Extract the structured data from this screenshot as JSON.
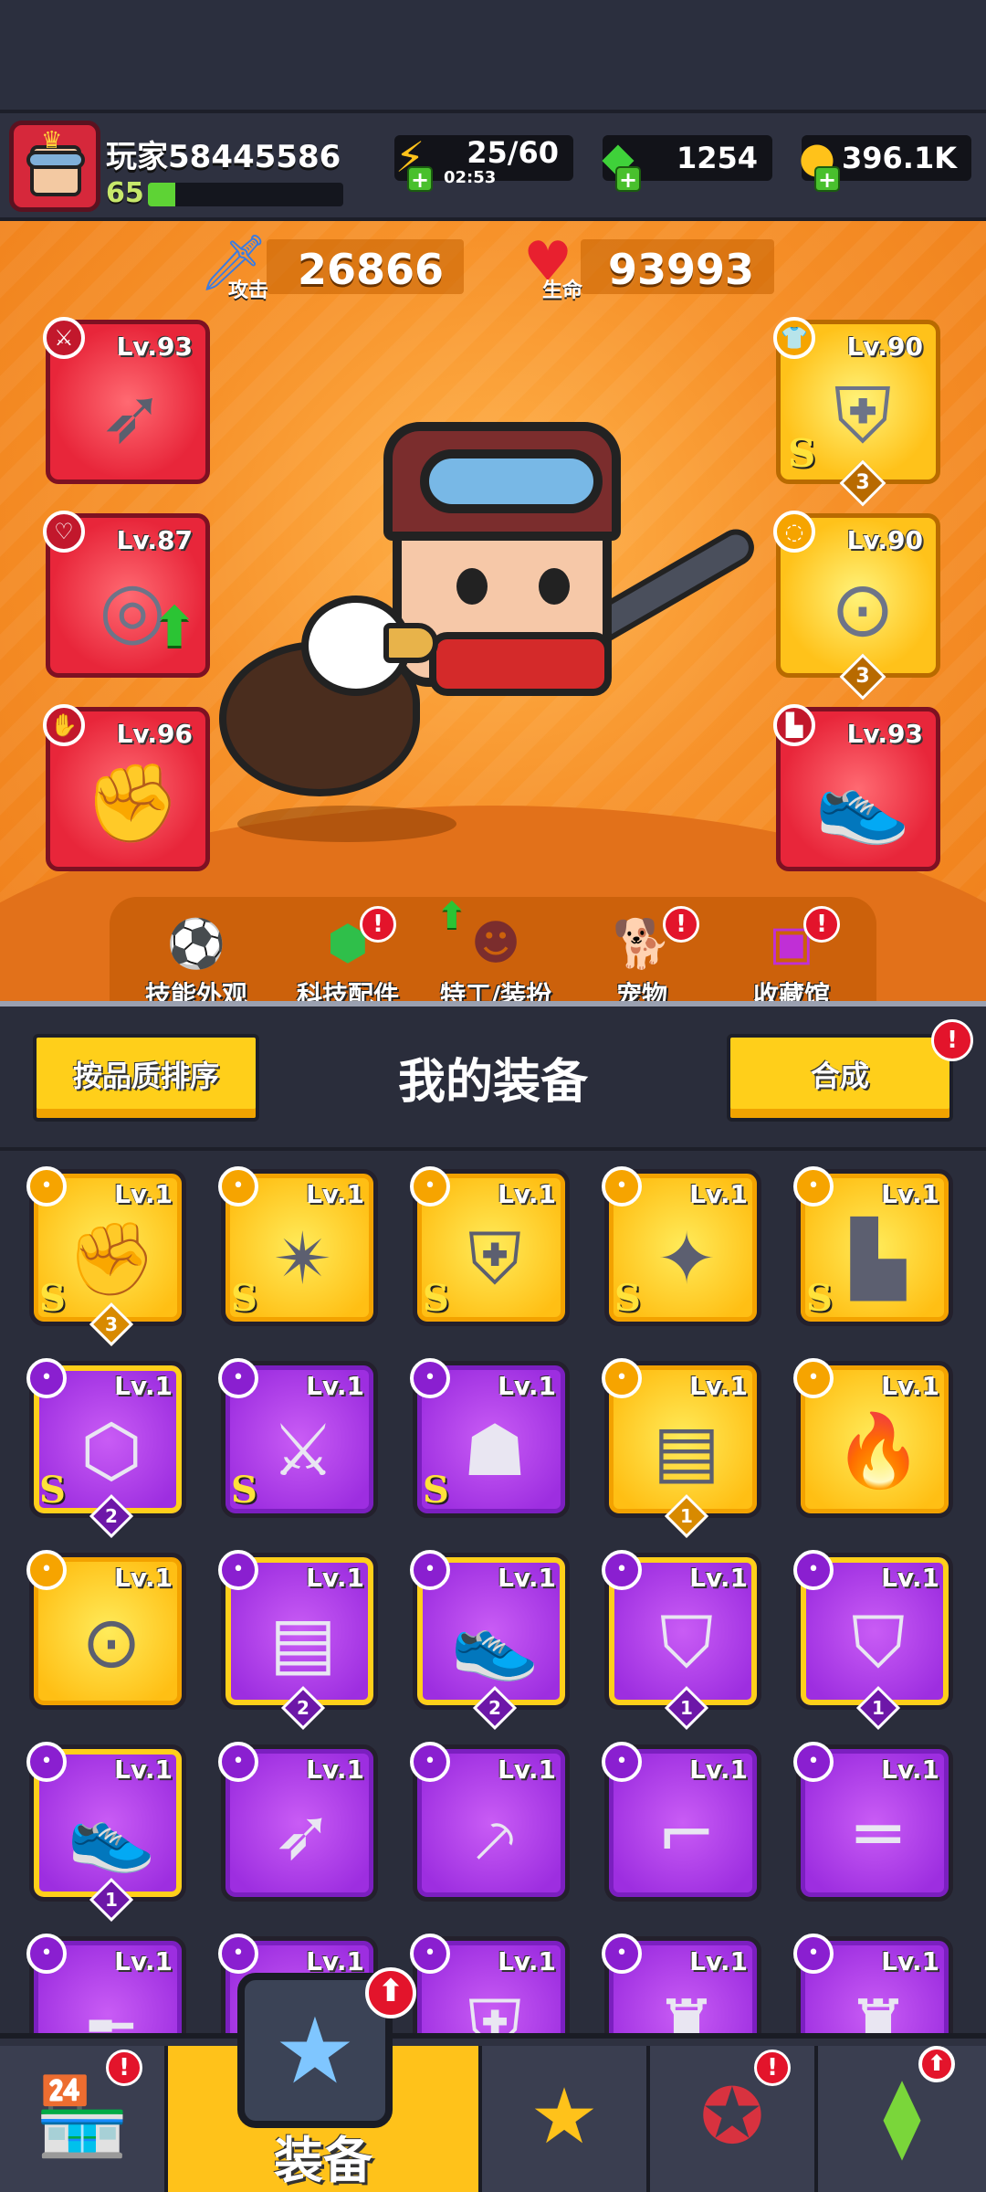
{
  "player": {
    "name": "玩家58445586",
    "level": "65",
    "xp_fraction": 0.14
  },
  "resources": {
    "energy": {
      "value": "25/60",
      "timer": "02:53",
      "icon": "lightning-icon"
    },
    "gems": {
      "value": "1254",
      "icon": "green-gem-icon"
    },
    "coins": {
      "value": "396.1K",
      "icon": "gold-coin-icon"
    }
  },
  "stats": {
    "attack": {
      "label": "攻击",
      "value": "26866",
      "icon": "sword-icon"
    },
    "health": {
      "label": "生命",
      "value": "93993",
      "icon": "heart-icon"
    }
  },
  "equipped": {
    "left": [
      {
        "level": "Lv.93",
        "type": "weapon",
        "icon": "kunai-icon",
        "quality": "red"
      },
      {
        "level": "Lv.87",
        "type": "necklace",
        "icon": "spiked-collar-icon",
        "quality": "red",
        "upgradable": true
      },
      {
        "level": "Lv.96",
        "type": "glove",
        "icon": "gauntlet-icon",
        "quality": "red"
      }
    ],
    "right": [
      {
        "level": "Lv.90",
        "type": "armor",
        "icon": "mech-armor-icon",
        "quality": "gold",
        "grade": "S",
        "stars": "3"
      },
      {
        "level": "Lv.90",
        "type": "belt",
        "icon": "star-belt-icon",
        "quality": "gold",
        "stars": "3"
      },
      {
        "level": "Lv.93",
        "type": "boots",
        "icon": "sneaker-icon",
        "quality": "red"
      }
    ]
  },
  "hero_menu": [
    {
      "label": "技能外观",
      "icon": "skin-ball-icon",
      "alert": false
    },
    {
      "label": "科技配件",
      "icon": "hex-chip-icon",
      "alert": true
    },
    {
      "label": "特工/装扮",
      "icon": "agent-icon",
      "alert": false,
      "upgrade": true
    },
    {
      "label": "宠物",
      "icon": "shiba-icon",
      "alert": true
    },
    {
      "label": "收藏馆",
      "icon": "chest-icon",
      "alert": true
    }
  ],
  "equipment_panel": {
    "sort_label": "按品质排序",
    "title": "我的装备",
    "merge_label": "合成",
    "merge_alert": "!"
  },
  "inventory": [
    {
      "level": "Lv.1",
      "quality": "gold",
      "icon": "gauntlet-icon",
      "grade": "S",
      "stars": "3"
    },
    {
      "level": "Lv.1",
      "quality": "gold",
      "icon": "star-blade-icon",
      "grade": "S"
    },
    {
      "level": "Lv.1",
      "quality": "gold",
      "icon": "mech-armor-icon",
      "grade": "S"
    },
    {
      "level": "Lv.1",
      "quality": "gold",
      "icon": "star-necklace-icon",
      "grade": "S"
    },
    {
      "level": "Lv.1",
      "quality": "gold",
      "icon": "boots-icon",
      "grade": "S"
    },
    {
      "level": "Lv.1",
      "quality": "purple",
      "frame": "gold",
      "icon": "hex-belt-icon",
      "grade": "S",
      "stars": "2"
    },
    {
      "level": "Lv.1",
      "quality": "purple",
      "icon": "fire-sword-icon",
      "grade": "S"
    },
    {
      "level": "Lv.1",
      "quality": "purple",
      "icon": "robot-armor-icon",
      "grade": "S"
    },
    {
      "level": "Lv.1",
      "quality": "gold",
      "icon": "vest-icon",
      "stars": "1"
    },
    {
      "level": "Lv.1",
      "quality": "gold",
      "icon": "torch-icon"
    },
    {
      "level": "Lv.1",
      "quality": "gold",
      "icon": "star-belt-icon"
    },
    {
      "level": "Lv.1",
      "quality": "purple",
      "frame": "gold",
      "icon": "vest-icon",
      "stars": "2"
    },
    {
      "level": "Lv.1",
      "quality": "purple",
      "frame": "gold",
      "icon": "sneaker-icon",
      "stars": "2"
    },
    {
      "level": "Lv.1",
      "quality": "purple",
      "frame": "gold",
      "icon": "shield-necklace-icon",
      "stars": "1"
    },
    {
      "level": "Lv.1",
      "quality": "purple",
      "frame": "gold",
      "icon": "shield-necklace-icon",
      "stars": "1"
    },
    {
      "level": "Lv.1",
      "quality": "purple",
      "frame": "gold",
      "icon": "sneaker-icon",
      "stars": "1"
    },
    {
      "level": "Lv.1",
      "quality": "purple",
      "icon": "kunai-icon"
    },
    {
      "level": "Lv.1",
      "quality": "purple",
      "icon": "machete-icon"
    },
    {
      "level": "Lv.1",
      "quality": "purple",
      "icon": "revolver-icon"
    },
    {
      "level": "Lv.1",
      "quality": "purple",
      "icon": "shotgun-icon"
    },
    {
      "level": "Lv.1",
      "quality": "purple",
      "icon": "rifle-icon"
    },
    {
      "level": "Lv.1",
      "quality": "purple",
      "icon": "armor-icon"
    },
    {
      "level": "Lv.1",
      "quality": "purple",
      "icon": "armor-icon"
    },
    {
      "level": "Lv.1",
      "quality": "purple",
      "icon": "spiked-armor-icon"
    },
    {
      "level": "Lv.1",
      "quality": "purple",
      "icon": "spiked-armor-icon"
    }
  ],
  "bottom_nav": [
    {
      "label": "",
      "icon": "shop-icon",
      "alert": true
    },
    {
      "label": "装备",
      "icon": "equipment-icon",
      "active": true,
      "upgrade": true
    },
    {
      "label": "",
      "icon": "crossed-swords-star-icon",
      "alert": false
    },
    {
      "label": "",
      "icon": "star-ball-icon",
      "alert": true
    },
    {
      "label": "",
      "icon": "dna-capsule-icon",
      "upgrade": true
    }
  ]
}
